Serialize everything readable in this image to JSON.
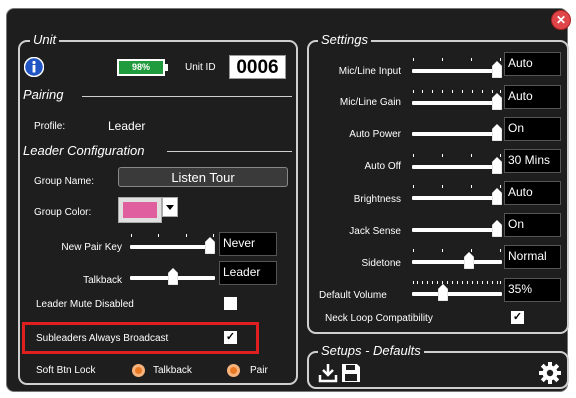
{
  "unit": {
    "title": "Unit",
    "battery": "98%",
    "unit_id_label": "Unit ID",
    "unit_id": "0006"
  },
  "pairing": {
    "title": "Pairing",
    "profile_label": "Profile:",
    "profile_value": "Leader"
  },
  "leader_config": {
    "title": "Leader Configuration",
    "group_name_label": "Group Name:",
    "group_name": "Listen Tour",
    "group_color_label": "Group Color:",
    "group_color": "#e0609f",
    "new_pair_key_label": "New Pair Key",
    "new_pair_key_value": "Never",
    "new_pair_key_level": 1.0,
    "talkback_label": "Talkback",
    "talkback_value": "Leader",
    "talkback_level": 0.5,
    "leader_mute_label": "Leader Mute Disabled",
    "leader_mute_checked": "",
    "subleaders_label": "Subleaders Always Broadcast",
    "subleaders_checked": "✓",
    "soft_btn_lock_label": "Soft Btn Lock",
    "soft_btn_talkback": "Talkback",
    "soft_btn_pair": "Pair"
  },
  "settings": {
    "title": "Settings",
    "mic_line_input_label": "Mic/Line Input",
    "mic_line_input_value": "Auto",
    "mic_line_gain_label": "Mic/Line Gain",
    "mic_line_gain_value": "Auto",
    "auto_power_label": "Auto Power",
    "auto_power_value": "On",
    "auto_off_label": "Auto Off",
    "auto_off_value": "30 Mins",
    "brightness_label": "Brightness",
    "brightness_value": "Auto",
    "jack_sense_label": "Jack Sense",
    "jack_sense_value": "On",
    "sidetone_label": "Sidetone",
    "sidetone_value": "Normal",
    "default_volume_label": "Default Volume",
    "default_volume_value": "35%",
    "neck_loop_label": "Neck Loop Compatibility",
    "neck_loop_checked": "✓"
  },
  "setups": {
    "title": "Setups - Defaults"
  },
  "colors": {
    "battery": "#1f9a3c",
    "highlight": "#e02020",
    "radio": "#e97a25",
    "close": "#e0454a"
  },
  "icons": {
    "info": "info-icon",
    "import": "download-icon",
    "save": "save-icon",
    "settings": "gear-icon",
    "close": "close-icon"
  }
}
